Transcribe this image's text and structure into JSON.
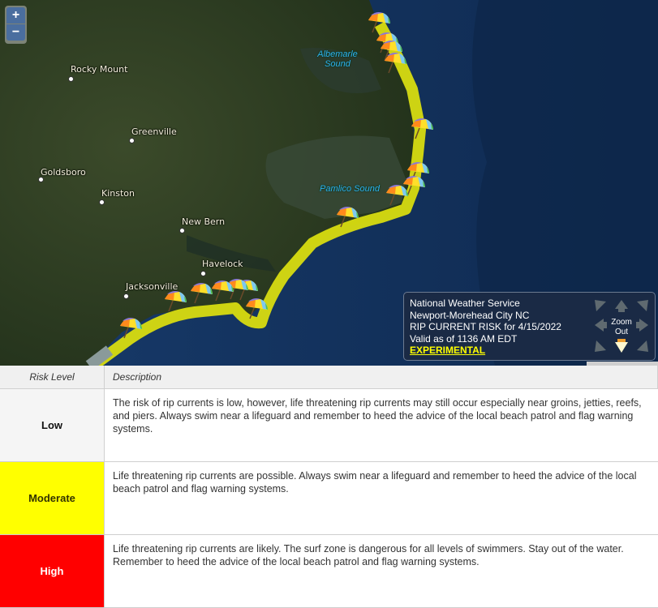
{
  "map": {
    "zoom_in_label": "+",
    "zoom_out_label": "−",
    "cities": [
      {
        "name": "Rocky Mount"
      },
      {
        "name": "Greenville"
      },
      {
        "name": "Goldsboro"
      },
      {
        "name": "Kinston"
      },
      {
        "name": "New Bern"
      },
      {
        "name": "Havelock"
      },
      {
        "name": "Jacksonville"
      }
    ],
    "water_labels": [
      {
        "name": "Albemarle Sound"
      },
      {
        "name": "Pamlico Sound"
      }
    ],
    "risk_line_color": "#e8e820",
    "beach_umbrella_icon": "beach-umbrella-icon"
  },
  "info_panel": {
    "line1": "National Weather Service",
    "line2": "Newport-Morehead City NC",
    "line3": "RIP CURRENT RISK for 4/15/2022",
    "line4": "Valid as of 1136 AM EDT",
    "experimental_link": "EXPERIMENTAL",
    "zoom_out_label_1": "Zoom",
    "zoom_out_label_2": "Out"
  },
  "legend_table": {
    "headers": {
      "level": "Risk Level",
      "description": "Description"
    },
    "rows": [
      {
        "level": "Low",
        "color": "#f5f5f5",
        "text_color": "#111111",
        "description": "The risk of rip currents is low, however, life threatening rip currents may still occur especially near groins, jetties, reefs, and piers. Always swim near a lifeguard and remember to heed the advice of the local beach patrol and flag warning systems."
      },
      {
        "level": "Moderate",
        "color": "#ffff00",
        "text_color": "#333300",
        "description": "Life threatening rip currents are possible. Always swim near a lifeguard and remember to heed the advice of the local beach patrol and flag warning systems."
      },
      {
        "level": "High",
        "color": "#ff0000",
        "text_color": "#ffffff",
        "description": "Life threatening rip currents are likely. The surf zone is dangerous for all levels of swimmers. Stay out of the water. Remember to heed the advice of the local beach patrol and flag warning systems."
      }
    ]
  }
}
